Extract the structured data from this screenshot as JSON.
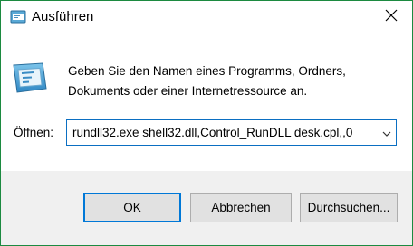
{
  "window": {
    "title": "Ausführen",
    "title_icon": "run-icon",
    "close_icon": "close-icon",
    "border_color": "#1c8a40",
    "accent_color": "#0078d7"
  },
  "content": {
    "icon": "run-app-icon",
    "description_line1": "Geben Sie den Namen eines Programms, Ordners,",
    "description_line2": "Dokuments oder einer Internetressource an.",
    "open_label": "Öffnen:",
    "combo_value": "rundll32.exe shell32.dll,Control_RunDLL desk.cpl,,0",
    "combo_arrow_icon": "chevron-down-icon"
  },
  "buttons": {
    "ok": "OK",
    "cancel": "Abbrechen",
    "browse": "Durchsuchen..."
  }
}
